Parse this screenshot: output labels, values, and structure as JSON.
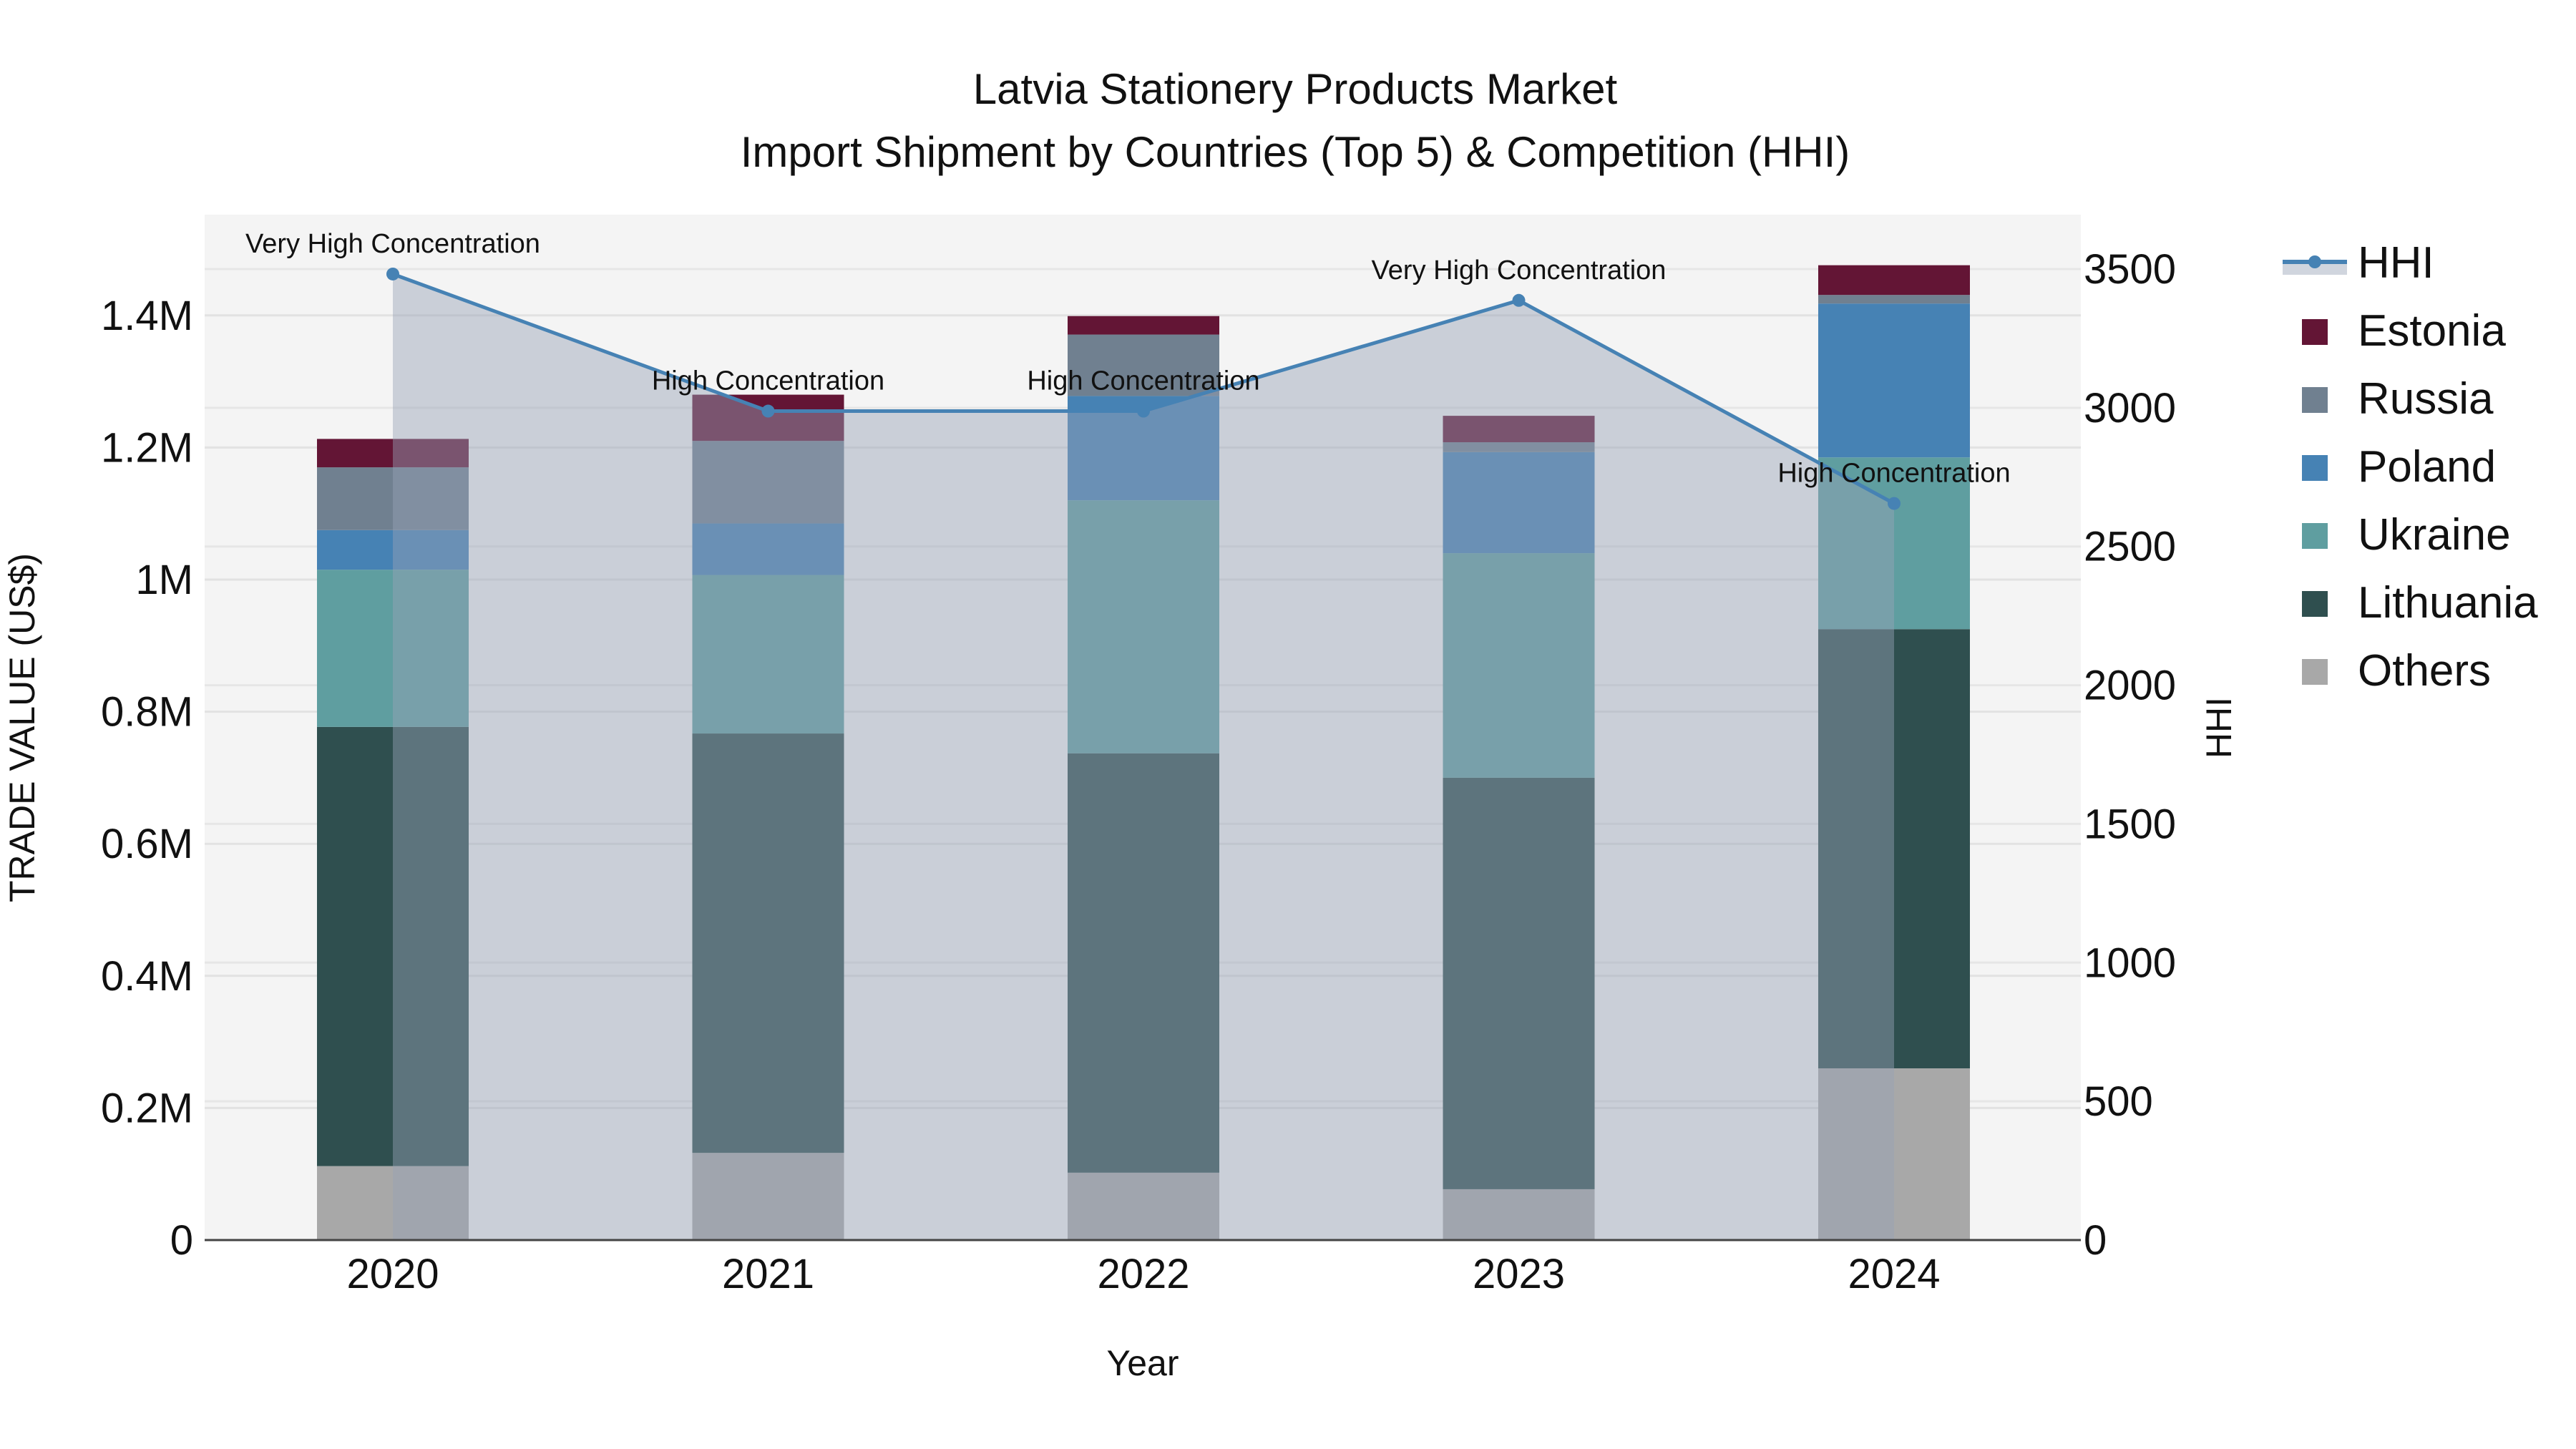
{
  "chart_data": {
    "type": "bar",
    "title": "Latvia Stationery Products Market",
    "subtitle": "Import Shipment by Countries (Top 5) & Competition (HHI)",
    "xlabel": "Year",
    "ylabel": "TRADE VALUE (US$)",
    "y2label": "HHI",
    "categories": [
      "2020",
      "2021",
      "2022",
      "2023",
      "2024"
    ],
    "ylim": [
      0,
      1550000
    ],
    "y_ticks": [
      0,
      200000,
      400000,
      600000,
      800000,
      1000000,
      1200000,
      1400000
    ],
    "y_tick_labels": [
      "0",
      "0.2M",
      "0.4M",
      "0.6M",
      "0.8M",
      "1M",
      "1.2M",
      "1.4M"
    ],
    "y2lim": [
      0,
      3700
    ],
    "y2_ticks": [
      0,
      500,
      1000,
      1500,
      2000,
      2500,
      3000,
      3500
    ],
    "y2_tick_labels": [
      "0",
      "500",
      "1000",
      "1500",
      "2000",
      "2500",
      "3000",
      "3500"
    ],
    "grid": true,
    "legend_position": "right",
    "series": [
      {
        "name": "Others",
        "color": "#a8a8a8",
        "values": [
          112000,
          132000,
          102000,
          77000,
          260000
        ]
      },
      {
        "name": "Lithuania",
        "color": "#2f4f4f",
        "values": [
          665000,
          635000,
          635000,
          623000,
          665000
        ]
      },
      {
        "name": "Ukraine",
        "color": "#5f9ea0",
        "values": [
          238000,
          240000,
          383000,
          340000,
          260000
        ]
      },
      {
        "name": "Poland",
        "color": "#4682b4",
        "values": [
          60000,
          78000,
          158000,
          153000,
          233000
        ]
      },
      {
        "name": "Russia",
        "color": "#708090",
        "values": [
          95000,
          125000,
          93000,
          15000,
          13000
        ]
      },
      {
        "name": "Estonia",
        "color": "#631535",
        "values": [
          43000,
          70000,
          28000,
          40000,
          45000
        ]
      }
    ],
    "hhi": {
      "name": "HHI",
      "color": "#4682b4",
      "values": [
        3482,
        2988,
        2988,
        3387,
        2655
      ],
      "annotations": [
        "Very High Concentration",
        "High Concentration",
        "High Concentration",
        "Very High Concentration",
        "High Concentration"
      ]
    },
    "legend_order": [
      "HHI",
      "Estonia",
      "Russia",
      "Poland",
      "Ukraine",
      "Lithuania",
      "Others"
    ]
  }
}
